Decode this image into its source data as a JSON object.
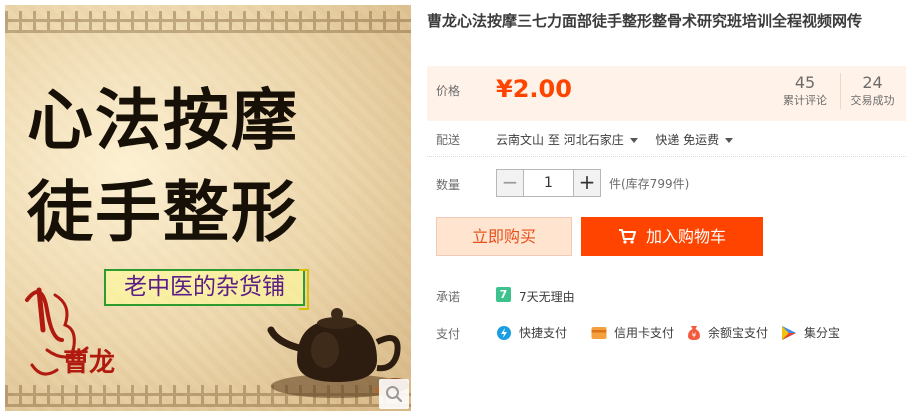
{
  "product": {
    "title": "曹龙心法按摩三七力面部徒手整形整骨术研究班培训全程视频网传",
    "image": {
      "headline_line1": "心法按摩",
      "headline_line2": "徒手整形",
      "shop_name": "老中医的杂货铺",
      "brand": "曹龙",
      "zoom_icon": "search-icon"
    }
  },
  "price": {
    "label": "价格",
    "value": "¥2.00",
    "reviews_count": "45",
    "reviews_label": "累计评论",
    "deals_count": "24",
    "deals_label": "交易成功"
  },
  "shipping": {
    "label": "配送",
    "from": "云南文山",
    "to_word": "至",
    "destination": "河北石家庄",
    "method": "快递 免运费"
  },
  "quantity": {
    "label": "数量",
    "value": "1",
    "minus": "−",
    "plus": "+",
    "stock": "件(库存799件)"
  },
  "actions": {
    "buy_now": "立即购买",
    "add_to_cart": "加入购物车"
  },
  "promise": {
    "label": "承诺",
    "badge": "7",
    "text": "7天无理由"
  },
  "payment": {
    "label": "支付",
    "methods": [
      {
        "label": "快捷支付",
        "icon": "quick-pay-icon"
      },
      {
        "label": "信用卡支付",
        "icon": "credit-card-icon"
      },
      {
        "label": "余额宝支付",
        "icon": "yuebao-icon"
      },
      {
        "label": "集分宝",
        "icon": "jifenbao-icon"
      }
    ]
  },
  "colors": {
    "accent": "#ff4400",
    "price_bg": "#fff2e8",
    "buy_now_bg": "#ffe4d0"
  }
}
